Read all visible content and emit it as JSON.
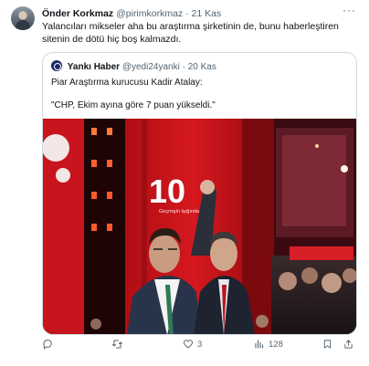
{
  "tweet": {
    "author_name": "Önder Korkmaz",
    "author_handle": "@pirimkorkmaz",
    "separator": "·",
    "time": "21 Kas",
    "more": "···",
    "text": "Yalancıları mikseler aha bu araştırma şirketinin de, bunu haberleştiren sitenin de dötü hiç boş kalmazdı."
  },
  "quoted_tweet": {
    "author_name": "Yankı Haber",
    "author_handle": "@yedi24yanki",
    "separator": "·",
    "time": "20 Kas",
    "line1": "Piar Araştırma kurucusu Kadir Atalay:",
    "line2": "\"CHP, Ekim ayına göre 7 puan yükseldi.\"",
    "photo_caption": "Geçmişin Işığında",
    "photo_number": "10"
  },
  "actions": {
    "reply_count": "",
    "retweet_count": "",
    "like_count": "3",
    "views_count": "128"
  },
  "colors": {
    "text_primary": "#0f1419",
    "text_secondary": "#536471",
    "border": "#cfd9de",
    "stage_red": "#c8141c",
    "stage_dark": "#2a0608"
  }
}
